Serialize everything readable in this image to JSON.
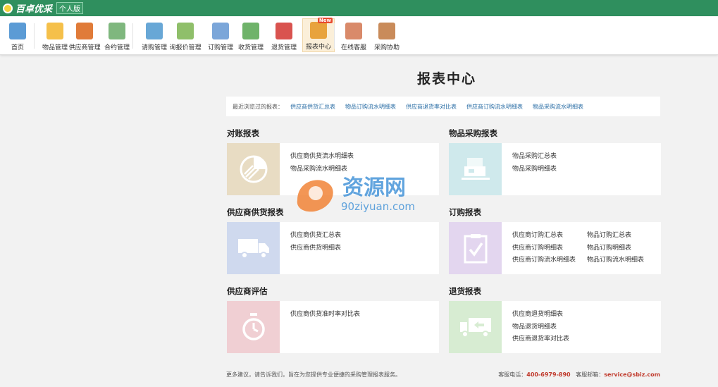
{
  "app": {
    "brand": "百卓优采",
    "edition": "个人版"
  },
  "toolbar": [
    {
      "label": "首页",
      "icon": "home-icon",
      "color": "#5b9bd5"
    },
    {
      "label": "物品管理",
      "icon": "box-icon",
      "color": "#f5c04a"
    },
    {
      "label": "供应商管理",
      "icon": "supplier-icon",
      "color": "#e07b39"
    },
    {
      "label": "合约管理",
      "icon": "contract-icon",
      "color": "#7fb77e"
    },
    {
      "label": "请购管理",
      "icon": "request-icon",
      "color": "#68a7d6"
    },
    {
      "label": "询报价管理",
      "icon": "quote-icon",
      "color": "#8fbf6a"
    },
    {
      "label": "订购管理",
      "icon": "order-icon",
      "color": "#7ba6d9"
    },
    {
      "label": "收货管理",
      "icon": "receive-icon",
      "color": "#6fb36a"
    },
    {
      "label": "退货管理",
      "icon": "return-icon",
      "color": "#d9534f"
    },
    {
      "label": "报表中心",
      "icon": "report-icon",
      "color": "#e8a33d",
      "badge": "New"
    },
    {
      "label": "在线客服",
      "icon": "service-icon",
      "color": "#d98a6a"
    },
    {
      "label": "采购协助",
      "icon": "assist-icon",
      "color": "#c98b5a"
    }
  ],
  "page_title": "报表中心",
  "recent": {
    "label": "最近浏览过的报表：",
    "links": [
      "供应商供货汇总表",
      "物品订购流水明细表",
      "供应商退货率对比表",
      "供应商订购流水明细表",
      "物品采购流水明细表"
    ]
  },
  "sections": {
    "reconcile": {
      "title": "对账报表",
      "tile_color": "#e8dcc3",
      "icon": "pie-icon",
      "links": [
        "供应商供货流水明细表",
        "物品采购流水明细表"
      ]
    },
    "purchase": {
      "title": "物品采购报表",
      "tile_color": "#cfe9ec",
      "icon": "boxes-icon",
      "links": [
        "物品采购汇总表",
        "物品采购明细表"
      ]
    },
    "supply": {
      "title": "供应商供货报表",
      "tile_color": "#cfd9ee",
      "icon": "truck-icon",
      "links": [
        "供应商供货汇总表",
        "供应商供货明细表"
      ]
    },
    "order": {
      "title": "订购报表",
      "tile_color": "#e3d6ef",
      "icon": "clipboard-check-icon",
      "links": [
        "供应商订购汇总表",
        "供应商订购明细表",
        "供应商订购流水明细表"
      ],
      "links2": [
        "物品订购汇总表",
        "物品订购明细表",
        "物品订购流水明细表"
      ]
    },
    "evaluate": {
      "title": "供应商评估",
      "tile_color": "#f0cfd3",
      "icon": "stopwatch-icon",
      "links": [
        "供应商供货准时率对比表"
      ]
    },
    "returns": {
      "title": "退货报表",
      "tile_color": "#d7ecd2",
      "icon": "return-truck-icon",
      "links": [
        "供应商退货明细表",
        "物品退货明细表",
        "供应商退货率对比表"
      ]
    }
  },
  "footer": {
    "suggest": "更多建议，请告诉我们，旨在为您提供专业便捷的采购管理报表服务。",
    "phone_label": "客服电话：",
    "phone": "400-6979-890",
    "email_label": "客服邮箱：",
    "email": "service@sbiz.com"
  },
  "watermark": {
    "text1": "资源网",
    "text2": "90ziyuan.com"
  }
}
